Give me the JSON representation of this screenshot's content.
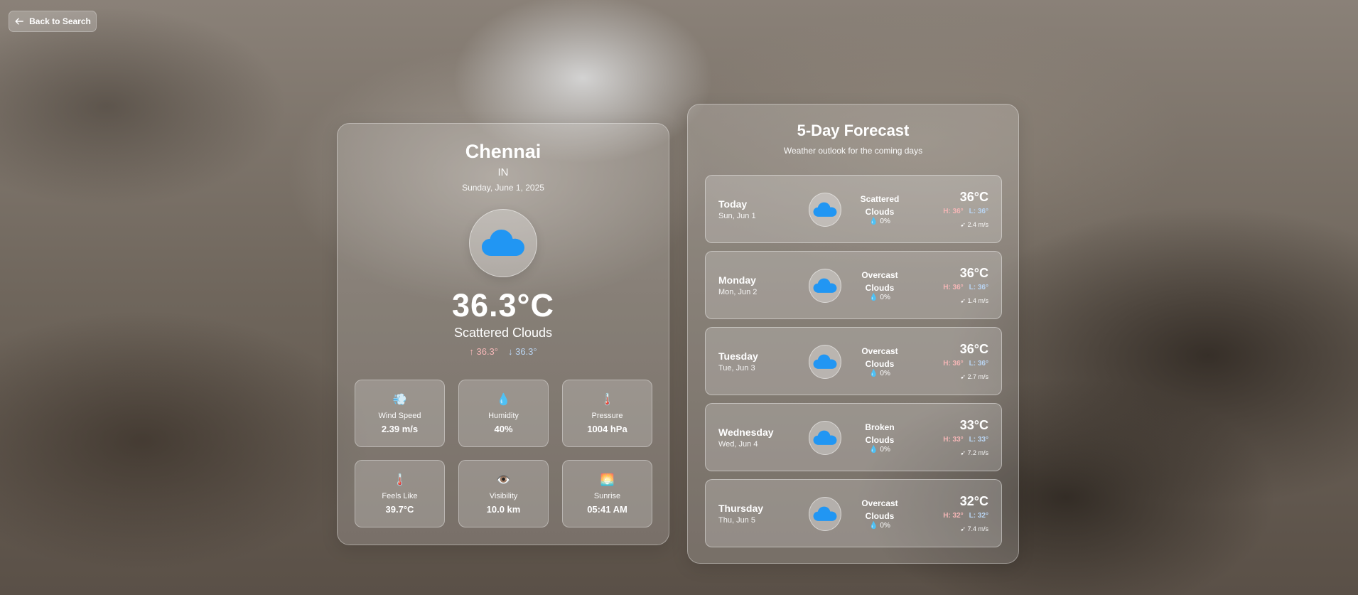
{
  "nav": {
    "back_label": "Back to Search"
  },
  "current": {
    "city": "Chennai",
    "country": "IN",
    "date": "Sunday, June 1, 2025",
    "icon": "cloud-icon",
    "temperature": "36.3°C",
    "condition": "Scattered Clouds",
    "high": "↑ 36.3°",
    "low": "↓ 36.3°",
    "stats": [
      {
        "icon": "wind-icon",
        "emoji": "💨",
        "label": "Wind Speed",
        "value": "2.39 m/s"
      },
      {
        "icon": "droplet-icon",
        "emoji": "💧",
        "label": "Humidity",
        "value": "40%"
      },
      {
        "icon": "thermometer-icon",
        "emoji": "🌡️",
        "label": "Pressure",
        "value": "1004 hPa"
      },
      {
        "icon": "thermometer-icon",
        "emoji": "🌡️",
        "label": "Feels Like",
        "value": "39.7°C"
      },
      {
        "icon": "eye-icon",
        "emoji": "👁️",
        "label": "Visibility",
        "value": "10.0 km"
      },
      {
        "icon": "sunrise-icon",
        "emoji": "🌅",
        "label": "Sunrise",
        "value": "05:41 AM"
      }
    ]
  },
  "forecast": {
    "title": "5-Day Forecast",
    "subtitle": "Weather outlook for the coming days",
    "days": [
      {
        "day": "Today",
        "date": "Sun, Jun 1",
        "cond1": "Scattered",
        "cond2": "Clouds",
        "precip": "0%",
        "temp": "36°C",
        "high": "H: 36°",
        "low": "L: 36°",
        "wind": "2.4 m/s"
      },
      {
        "day": "Monday",
        "date": "Mon, Jun 2",
        "cond1": "Overcast",
        "cond2": "Clouds",
        "precip": "0%",
        "temp": "36°C",
        "high": "H: 36°",
        "low": "L: 36°",
        "wind": "1.4 m/s"
      },
      {
        "day": "Tuesday",
        "date": "Tue, Jun 3",
        "cond1": "Overcast",
        "cond2": "Clouds",
        "precip": "0%",
        "temp": "36°C",
        "high": "H: 36°",
        "low": "L: 36°",
        "wind": "2.7 m/s"
      },
      {
        "day": "Wednesday",
        "date": "Wed, Jun 4",
        "cond1": "Broken",
        "cond2": "Clouds",
        "precip": "0%",
        "temp": "33°C",
        "high": "H: 33°",
        "low": "L: 33°",
        "wind": "7.2 m/s"
      },
      {
        "day": "Thursday",
        "date": "Thu, Jun 5",
        "cond1": "Overcast",
        "cond2": "Clouds",
        "precip": "0%",
        "temp": "32°C",
        "high": "H: 32°",
        "low": "L: 32°",
        "wind": "7.4 m/s"
      }
    ]
  },
  "colors": {
    "cloud": "#2196f3",
    "high": "#f4b6b6",
    "low": "#b9d4f2"
  }
}
